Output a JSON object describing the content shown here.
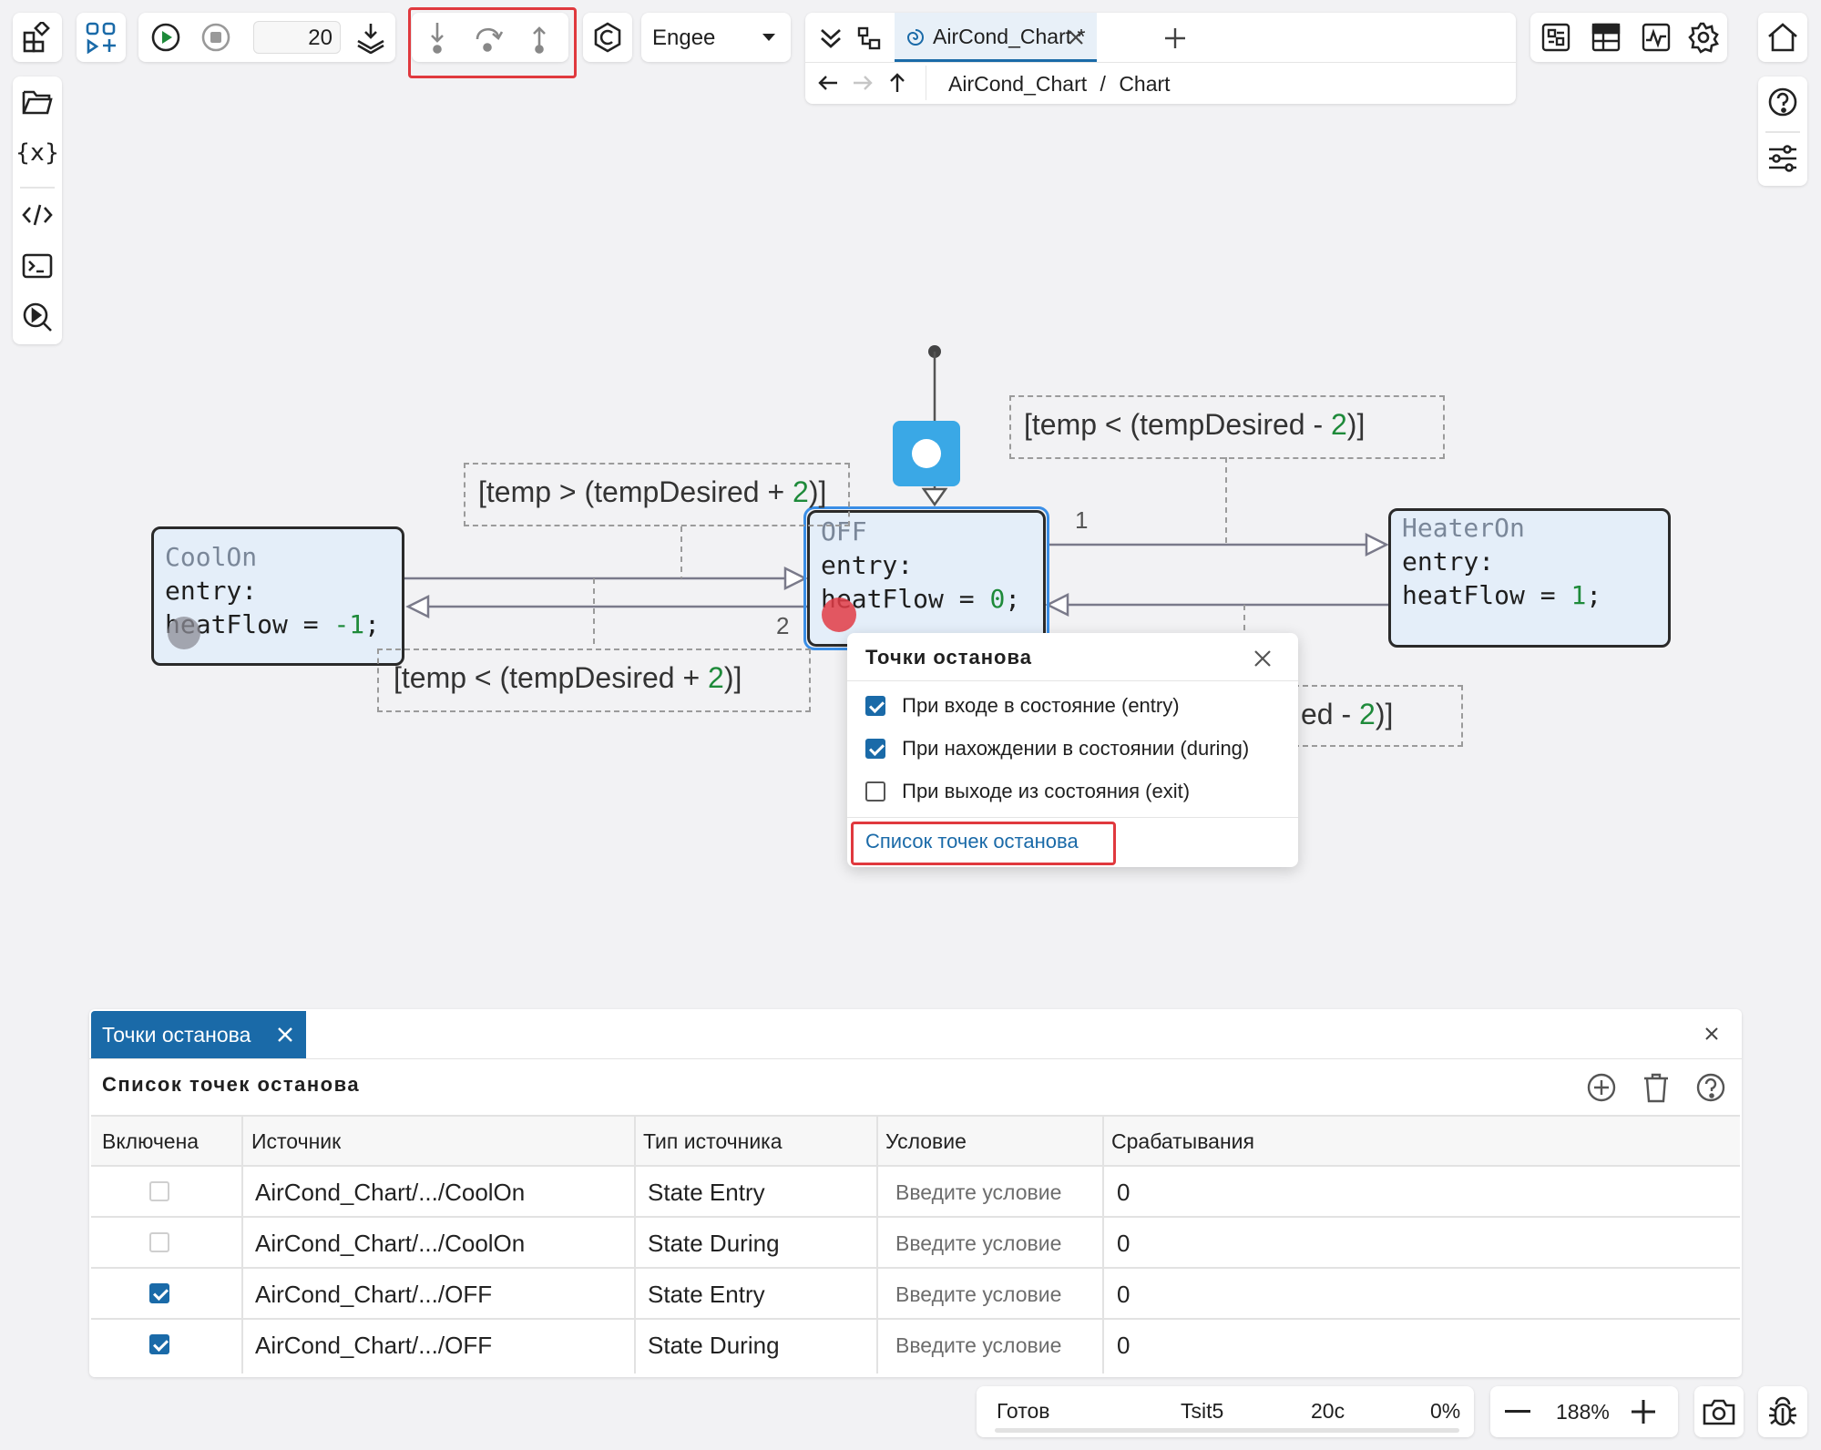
{
  "toolbar": {
    "step_value": "20",
    "solver_engine": "Engee"
  },
  "tabs": {
    "active_tab": "AirCond_Chart *"
  },
  "breadcrumb": {
    "root": "AirCond_Chart",
    "separator": "/",
    "leaf": "Chart"
  },
  "diagram": {
    "states": {
      "cool_on": {
        "name": "CoolOn",
        "entry": "entry:",
        "action_prefix": "heatFlow = ",
        "value": "-1",
        "suffix": ";"
      },
      "off": {
        "name": "OFF",
        "entry": "entry:",
        "action_prefix": "heatFlow = ",
        "value": "0",
        "suffix": ";"
      },
      "heater_on": {
        "name": "HeaterOn",
        "entry": "entry:",
        "action_prefix": "heatFlow = ",
        "value": "1",
        "suffix": ";"
      }
    },
    "guards": {
      "to_cool": {
        "pre": "[temp > (tempDesired + ",
        "num": "2",
        "post": ")]"
      },
      "from_cool": {
        "pre": "[temp < (tempDesired + ",
        "num": "2",
        "post": ")]"
      },
      "to_heater": {
        "pre": "[temp < (tempDesired - ",
        "num": "2",
        "post": ")]"
      },
      "from_heater": {
        "pre": "ed - ",
        "num": "2",
        "post": ")]"
      }
    },
    "priority_labels": {
      "to_heater": "1",
      "from_cool": "2"
    }
  },
  "breakpoint_popup": {
    "title": "Точки останова",
    "options": [
      {
        "label": "При входе в состояние (entry)",
        "checked": true
      },
      {
        "label": "При нахождении в состоянии (during)",
        "checked": true
      },
      {
        "label": "При выходе из состояния (exit)",
        "checked": false
      }
    ],
    "link": "Список точек останова"
  },
  "bottom_panel": {
    "tab_label": "Точки останова",
    "heading": "Список точек останова",
    "columns": [
      "Включена",
      "Источник",
      "Тип источника",
      "Условие",
      "Срабатывания"
    ],
    "rows": [
      {
        "enabled": false,
        "source": "AirCond_Chart/.../CoolOn",
        "type": "State Entry",
        "condition_placeholder": "Введите условие",
        "hits": "0"
      },
      {
        "enabled": false,
        "source": "AirCond_Chart/.../CoolOn",
        "type": "State During",
        "condition_placeholder": "Введите условие",
        "hits": "0"
      },
      {
        "enabled": true,
        "source": "AirCond_Chart/.../OFF",
        "type": "State Entry",
        "condition_placeholder": "Введите условие",
        "hits": "0"
      },
      {
        "enabled": true,
        "source": "AirCond_Chart/.../OFF",
        "type": "State During",
        "condition_placeholder": "Введите условие",
        "hits": "0"
      }
    ]
  },
  "status_bar": {
    "status": "Готов",
    "solver": "Tsit5",
    "time": "20с",
    "progress": "0%",
    "zoom": "188%"
  },
  "colors": {
    "accent": "#1a6aa8",
    "highlight": "#e0393e",
    "state_fill": "#e4eef9",
    "number": "#1e8a3a"
  }
}
